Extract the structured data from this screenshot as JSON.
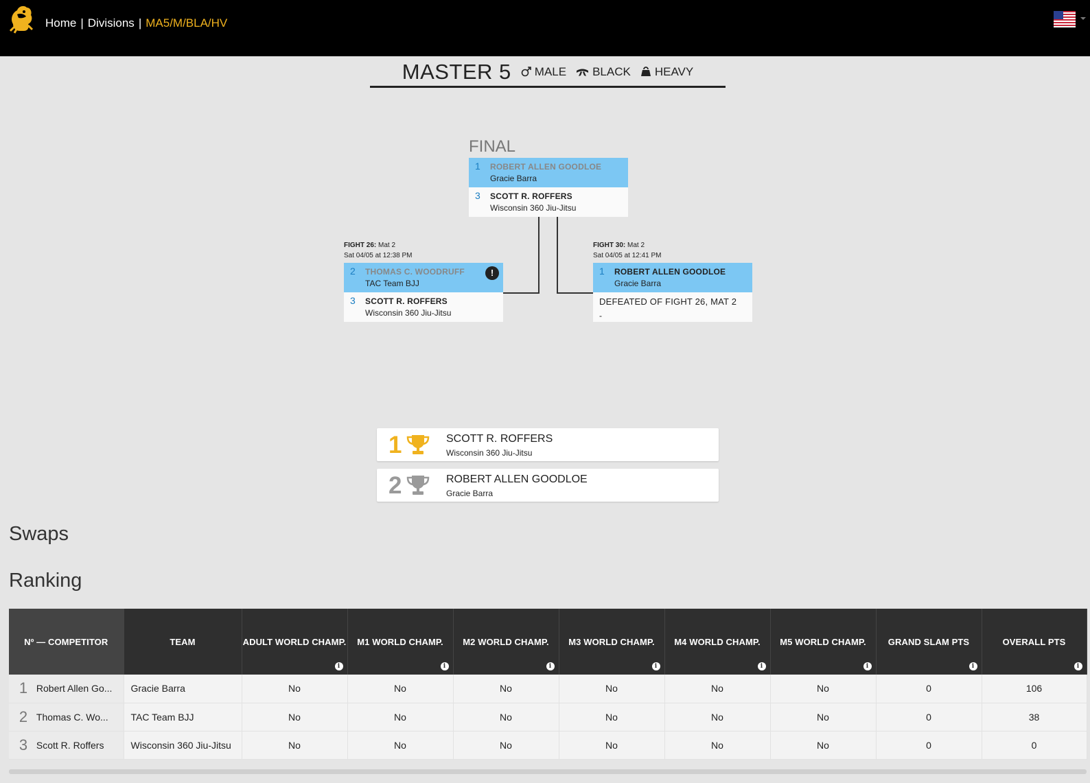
{
  "header": {
    "breadcrumb": [
      "Home",
      "Divisions",
      "MA5/M/BLA/HV"
    ],
    "separator": "|",
    "accent_color": "#f0b21e",
    "logo_icon": "lion-logo-icon",
    "flag_icon": "us-flag-icon"
  },
  "division": {
    "age": "MASTER 5",
    "gender": "MALE",
    "belt": "BLACK",
    "weight": "HEAVY"
  },
  "bracket": {
    "final_label": "FINAL",
    "final": {
      "top": {
        "seed": "1",
        "name": "ROBERT ALLEN GOODLOE",
        "team": "Gracie Barra"
      },
      "bottom": {
        "seed": "3",
        "name": "SCOTT R. ROFFERS",
        "team": "Wisconsin 360 Jiu-Jitsu"
      }
    },
    "fight26": {
      "label": "FIGHT 26:",
      "mat": "Mat 2",
      "time": "Sat 04/05 at 12:38 PM",
      "top": {
        "seed": "2",
        "name": "THOMAS C. WOODRUFF",
        "team": "TAC Team BJJ",
        "badge": "!"
      },
      "bottom": {
        "seed": "3",
        "name": "SCOTT R. ROFFERS",
        "team": "Wisconsin 360 Jiu-Jitsu"
      }
    },
    "fight30": {
      "label": "FIGHT 30:",
      "mat": "Mat 2",
      "time": "Sat 04/05 at 12:41 PM",
      "top": {
        "seed": "1",
        "name": "ROBERT ALLEN GOODLOE",
        "team": "Gracie Barra"
      },
      "bottom": {
        "text": "DEFEATED OF FIGHT 26, MAT 2",
        "sub": "-"
      }
    }
  },
  "podium": [
    {
      "place": "1",
      "name": "SCOTT R. ROFFERS",
      "team": "Wisconsin 360 Jiu-Jitsu",
      "color": "#f0b21e"
    },
    {
      "place": "2",
      "name": "ROBERT ALLEN GOODLOE",
      "team": "Gracie Barra",
      "color": "#9a9a9a"
    }
  ],
  "sections": {
    "swaps": "Swaps",
    "ranking": "Ranking"
  },
  "ranking": {
    "columns": [
      "Nº — COMPETITOR",
      "TEAM",
      "ADULT WORLD CHAMP.",
      "M1 WORLD CHAMP.",
      "M2 WORLD CHAMP.",
      "M3 WORLD CHAMP.",
      "M4 WORLD CHAMP.",
      "M5 WORLD CHAMP.",
      "GRAND SLAM PTS",
      "OVERALL PTS"
    ],
    "info_glyph": "i",
    "rows": [
      {
        "rank": "1",
        "name": "Robert Allen Go...",
        "team": "Gracie Barra",
        "adult": "No",
        "m1": "No",
        "m2": "No",
        "m3": "No",
        "m4": "No",
        "m5": "No",
        "gs": "0",
        "overall": "106"
      },
      {
        "rank": "2",
        "name": "Thomas C. Wo...",
        "team": "TAC Team BJJ",
        "adult": "No",
        "m1": "No",
        "m2": "No",
        "m3": "No",
        "m4": "No",
        "m5": "No",
        "gs": "0",
        "overall": "38"
      },
      {
        "rank": "3",
        "name": "Scott R. Roffers",
        "team": "Wisconsin 360 Jiu-Jitsu",
        "adult": "No",
        "m1": "No",
        "m2": "No",
        "m3": "No",
        "m4": "No",
        "m5": "No",
        "gs": "0",
        "overall": "0"
      }
    ]
  }
}
